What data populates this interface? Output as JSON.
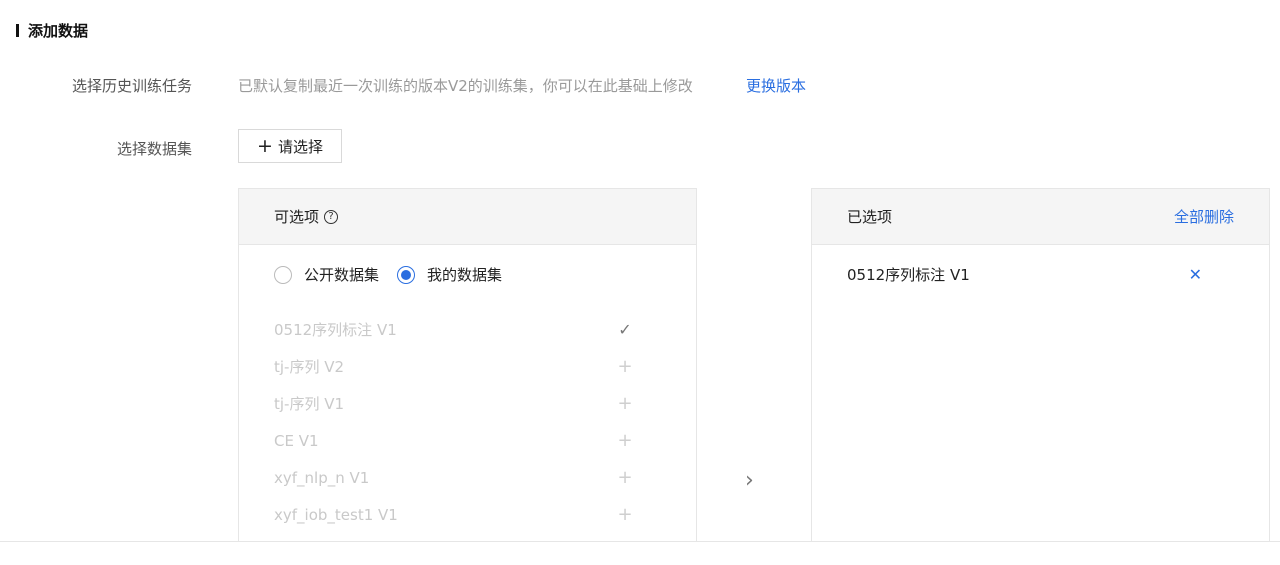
{
  "section_title": "添加数据",
  "form": {
    "history_label": "选择历史训练任务",
    "history_hint": "已默认复制最近一次训练的版本V2的训练集，你可以在此基础上修改",
    "change_version_link": "更换版本",
    "dataset_label": "选择数据集",
    "select_button_label": "请选择",
    "select_button_icon": "plus-icon"
  },
  "left_panel": {
    "title": "可选项",
    "help_icon": "question-circle-icon",
    "radios": [
      {
        "label": "公开数据集",
        "checked": false
      },
      {
        "label": "我的数据集",
        "checked": true
      }
    ],
    "options": [
      {
        "name": "0512序列标注 V1",
        "selected": true
      },
      {
        "name": "tj-序列 V2",
        "selected": false
      },
      {
        "name": "tj-序列 V1",
        "selected": false
      },
      {
        "name": "CE V1",
        "selected": false
      },
      {
        "name": "xyf_nlp_n V1",
        "selected": false
      },
      {
        "name": "xyf_iob_test1 V1",
        "selected": false
      }
    ]
  },
  "transfer_arrow_icon": "chevron-right-icon",
  "right_panel": {
    "title": "已选项",
    "delete_all": "全部删除",
    "items": [
      {
        "name": "0512序列标注 V1",
        "remove_icon": "close-icon"
      }
    ]
  },
  "colors": {
    "accent": "#2a6ee0",
    "panel_header_bg": "#f5f5f5",
    "disabled_text": "#c9c9c9"
  }
}
